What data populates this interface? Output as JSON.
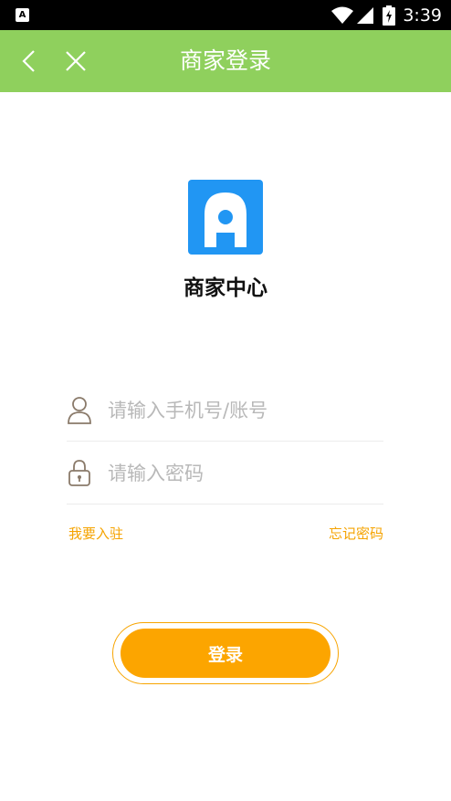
{
  "status_bar": {
    "time": "3:39",
    "left_icon_letter": "A"
  },
  "header": {
    "title": "商家登录"
  },
  "brand": {
    "name": "商家中心",
    "logo_color": "#2196f3"
  },
  "form": {
    "username_placeholder": "请输入手机号/账号",
    "password_placeholder": "请输入密码"
  },
  "links": {
    "register": "我要入驻",
    "forgot_password": "忘记密码"
  },
  "login_button": {
    "label": "登录"
  },
  "colors": {
    "header": "#8fd05d",
    "accent": "#fca500"
  }
}
